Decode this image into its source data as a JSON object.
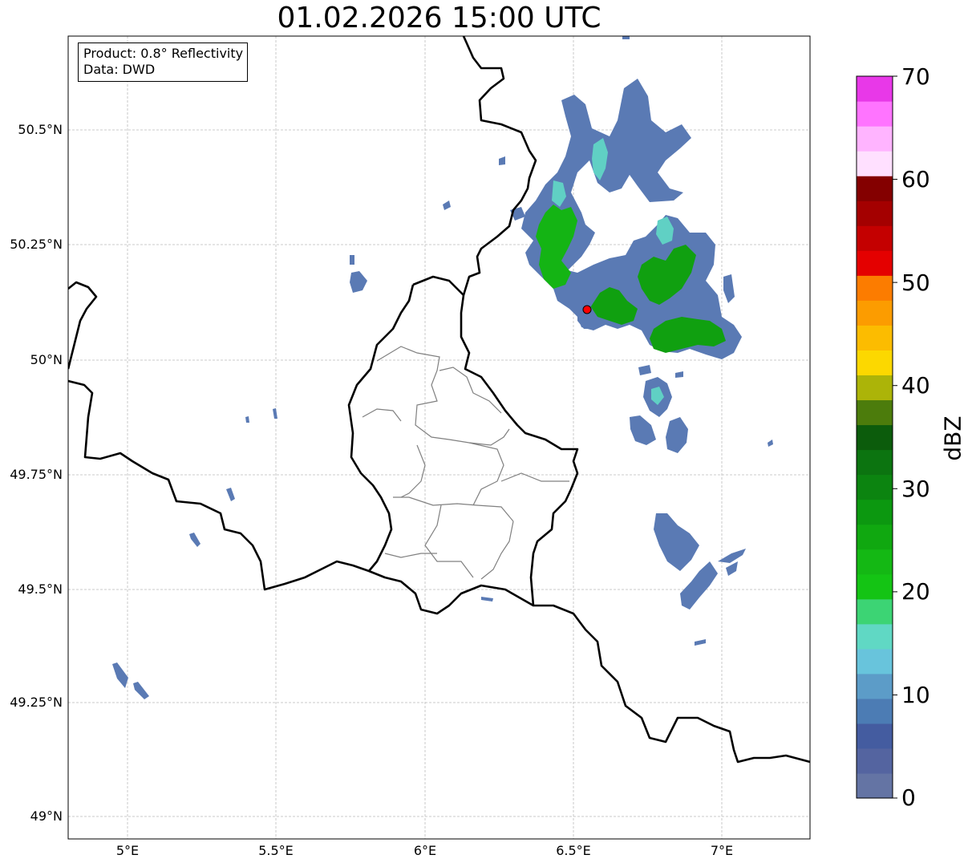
{
  "title": "01.02.2026 15:00 UTC",
  "info": {
    "product": "Product: 0.8° Reflectivity",
    "data": "Data: DWD"
  },
  "lat_ticks": [
    "50.5°N",
    "50.25°N",
    "50°N",
    "49.75°N",
    "49.5°N",
    "49.25°N",
    "49°N"
  ],
  "lon_ticks": [
    "5°E",
    "5.5°E",
    "6°E",
    "6.5°E",
    "7°E"
  ],
  "colorbar": {
    "label": "dBZ",
    "ticks": [
      "0",
      "10",
      "20",
      "30",
      "40",
      "50",
      "60",
      "70"
    ],
    "colors": [
      "#6474a4",
      "#5464a0",
      "#445ca0",
      "#4c7cb4",
      "#5c9cc8",
      "#68c4dc",
      "#60d8c4",
      "#3cd474",
      "#14c414",
      "#14b814",
      "#10a810",
      "#0c9810",
      "#0c8410",
      "#0c7410",
      "#0c5c0c",
      "#4c7c0c",
      "#acb408",
      "#fcd800",
      "#fcbc00",
      "#fc9c00",
      "#fc7c00",
      "#e40000",
      "#c40000",
      "#a40000",
      "#840000",
      "#ffe0ff",
      "#ffb4ff",
      "#ff74ff",
      "#e838e8"
    ],
    "value_range": [
      0,
      70
    ]
  },
  "map": {
    "extent": {
      "lon": [
        4.8,
        7.3
      ],
      "lat": [
        48.95,
        50.7
      ]
    },
    "radar_site": {
      "lon": 6.548,
      "lat": 50.11,
      "color": "#ff0000"
    },
    "border_color": "#000000",
    "district_color": "#808080"
  }
}
